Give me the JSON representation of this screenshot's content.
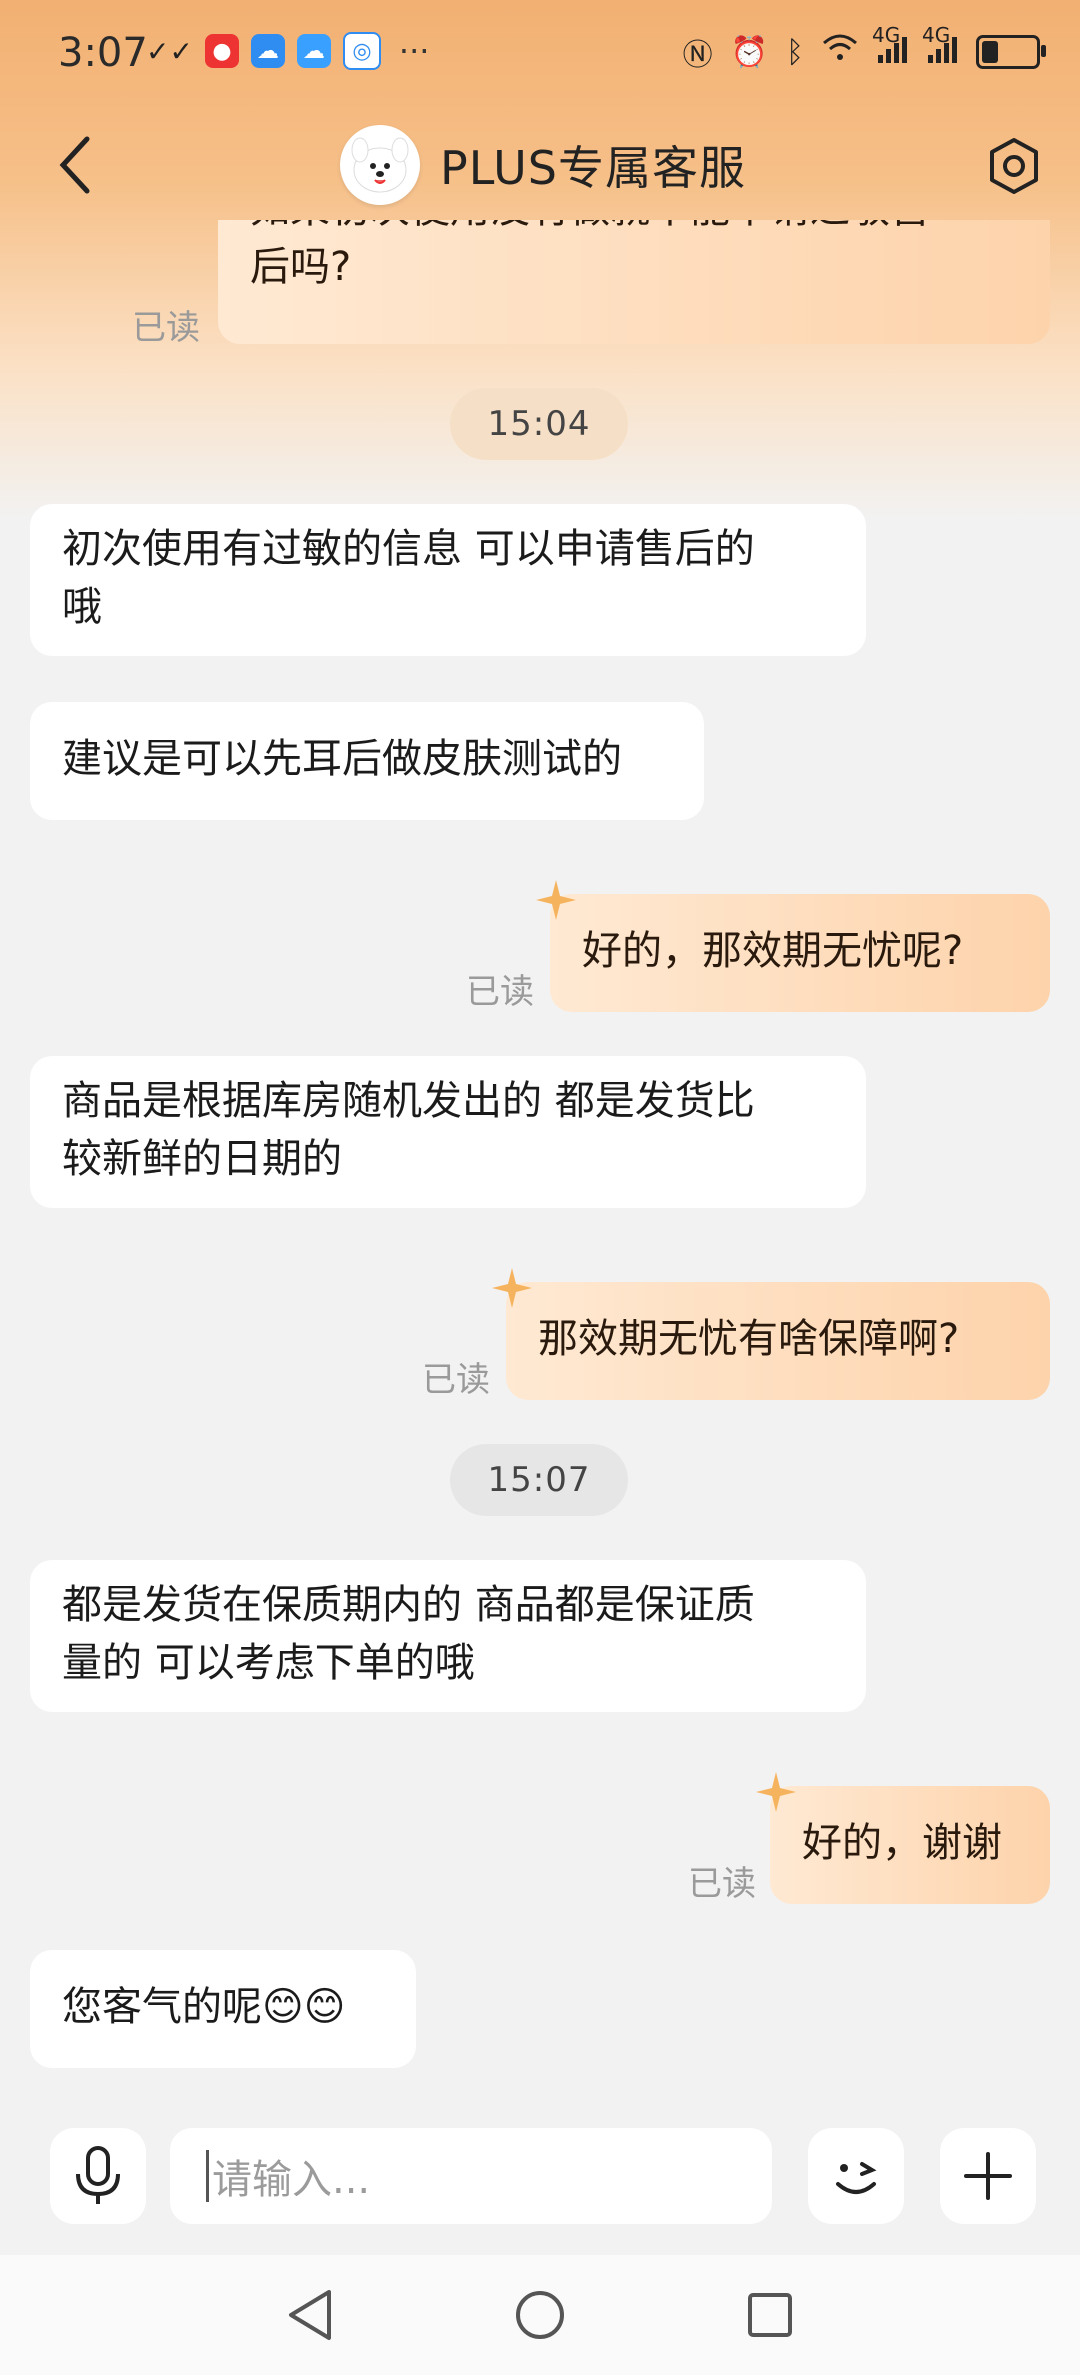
{
  "status_bar": {
    "time": "3:07",
    "more_dots": "···",
    "network_1": "4G",
    "network_2": "4G"
  },
  "header": {
    "title": "PLUS专属客服"
  },
  "messages": [
    {
      "side": "right",
      "text_line1": "如果初次使用没有做就不能申请过敏售",
      "text_line2": "后吗?",
      "read": "已读"
    },
    {
      "time": "15:04"
    },
    {
      "side": "left",
      "text_line1": "初次使用有过敏的信息  可以申请售后的",
      "text_line2": "哦"
    },
    {
      "side": "left",
      "text": "建议是可以先耳后做皮肤测试的"
    },
    {
      "side": "right",
      "text": "好的，那效期无忧呢?",
      "read": "已读"
    },
    {
      "side": "left",
      "text_line1": "商品是根据库房随机发出的  都是发货比",
      "text_line2": "较新鲜的日期的"
    },
    {
      "side": "right",
      "text": "那效期无忧有啥保障啊?",
      "read": "已读"
    },
    {
      "time": "15:07"
    },
    {
      "side": "left",
      "text_line1": "都是发货在保质期内的  商品都是保证质",
      "text_line2": "量的  可以考虑下单的哦"
    },
    {
      "side": "right",
      "text": "好的，谢谢",
      "read": "已读"
    },
    {
      "side": "left",
      "text": "您客气的呢😊😊"
    }
  ],
  "composer": {
    "placeholder": "请输入..."
  },
  "colors": {
    "accent": "#f6c089",
    "bubble_right": "#fdd3ab",
    "bubble_left": "#ffffff",
    "background": "#f2f2f2"
  }
}
